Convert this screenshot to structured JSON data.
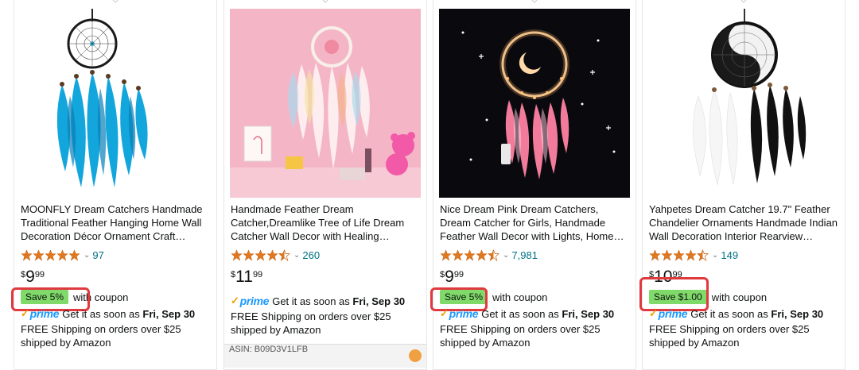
{
  "products": [
    {
      "title": "MOONFLY Dream Catchers Handmade Traditional Feather Hanging Home Wall Decoration Décor Ornament Craft Native...",
      "rating_stars": 5,
      "review_count": "97",
      "price": {
        "symbol": "$",
        "whole": "9",
        "fraction": "99"
      },
      "coupon_label": "Save 5%",
      "coupon_suffix": "with coupon",
      "prime_label": "prime",
      "delivery_prefix": "Get it as soon as",
      "delivery_date": "Fri, Sep 30",
      "shipping": "FREE Shipping on orders over $25 shipped by Amazon",
      "highlight_coupon": true
    },
    {
      "title": "Handmade Feather Dream Catcher,Dreamlike Tree of Life Dream Catcher Wall Decor with Healing Crystal...",
      "rating_stars": 4.5,
      "review_count": "260",
      "price": {
        "symbol": "$",
        "whole": "11",
        "fraction": "99"
      },
      "prime_label": "prime",
      "delivery_prefix": "Get it as soon as",
      "delivery_date": "Fri, Sep 30",
      "shipping": "FREE Shipping on orders over $25 shipped by Amazon",
      "asin_strip": "ASIN: B09D3V1LFB"
    },
    {
      "title": "Nice Dream Pink Dream Catchers, Dream Catcher for Girls, Handmade Feather Wall Decor with Lights, Home Ornaments Craf...",
      "rating_stars": 4.5,
      "review_count": "7,981",
      "price": {
        "symbol": "$",
        "whole": "9",
        "fraction": "99"
      },
      "coupon_label": "Save 5%",
      "coupon_suffix": "with coupon",
      "prime_label": "prime",
      "delivery_prefix": "Get it as soon as",
      "delivery_date": "Fri, Sep 30",
      "shipping": "FREE Shipping on orders over $25 shipped by Amazon",
      "highlight_coupon": true
    },
    {
      "title": "Yahpetes Dream Catcher 19.7\" Feather Chandelier Ornaments Handmade Indian Wall Decoration Interior Rearview Penda...",
      "rating_stars": 4.5,
      "review_count": "149",
      "price": {
        "symbol": "$",
        "whole": "10",
        "fraction": "99"
      },
      "coupon_label": "Save $1.00",
      "coupon_suffix": "with coupon",
      "prime_label": "prime",
      "delivery_prefix": "Get it as soon as",
      "delivery_date": "Fri, Sep 30",
      "shipping": "FREE Shipping on orders over $25 shipped by Amazon",
      "highlight_coupon": true
    }
  ],
  "colors": {
    "coupon_badge": "#7fda69",
    "highlight_box": "#e0393e",
    "link": "#007185",
    "star": "#de7921",
    "prime": "#1a98ff"
  }
}
